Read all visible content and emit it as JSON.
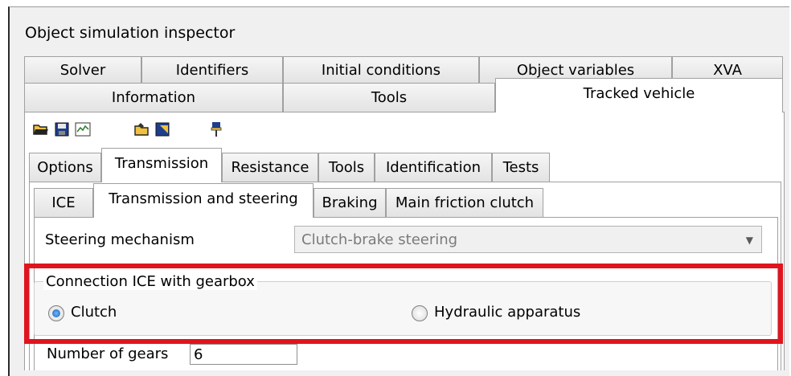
{
  "window": {
    "title": "Object simulation inspector"
  },
  "top_tabs_row1": [
    "Solver",
    "Identifiers",
    "Initial conditions",
    "Object variables",
    "XVA"
  ],
  "top_tabs_row2": [
    "Information",
    "Tools",
    "Tracked vehicle"
  ],
  "toolbar": {
    "icons": [
      "open-folder-icon",
      "save-icon",
      "chart-icon",
      "folder-edit-icon",
      "export-icon",
      "pin-icon"
    ]
  },
  "mid_tabs": [
    "Options",
    "Transmission",
    "Resistance",
    "Tools",
    "Identification",
    "Tests"
  ],
  "inner_tabs": [
    "ICE",
    "Transmission and steering",
    "Braking",
    "Main friction clutch"
  ],
  "steering": {
    "label": "Steering mechanism",
    "value": "Clutch-brake steering"
  },
  "connection": {
    "title": "Connection ICE with gearbox",
    "options": [
      "Clutch",
      "Hydraulic apparatus"
    ],
    "selected": "Clutch"
  },
  "gears": {
    "label": "Number of gears",
    "value": "6"
  },
  "colors": {
    "highlight": "#e0141e",
    "selected_tab": "#ffffff",
    "window_bg": "#f0f0f0"
  }
}
